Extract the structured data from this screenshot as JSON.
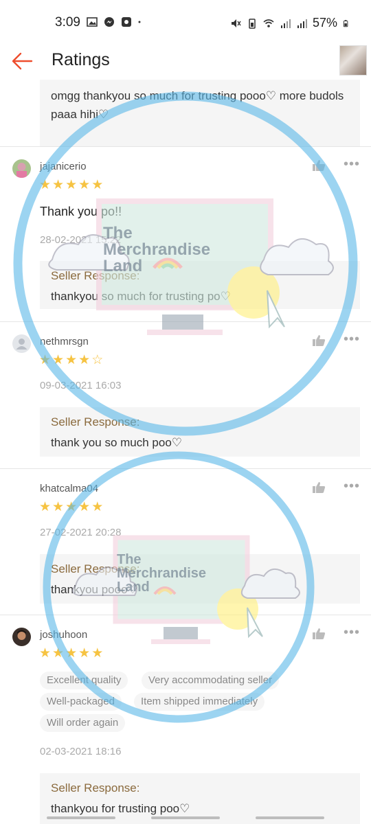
{
  "status_bar": {
    "time": "3:09",
    "battery": "57%"
  },
  "header": {
    "title": "Ratings"
  },
  "top_partial": {
    "response_text": "omgg thankyou so much for trusting pooo♡ more budols paaa hihi♡"
  },
  "reviews": [
    {
      "username": "jajanicerio",
      "stars": 5,
      "comment": "Thank you po!!",
      "date": "28-02-2021 15:22",
      "response_label": "Seller Response:",
      "response_text": "thankyou so much for trusting po♡"
    },
    {
      "username": "nethmrsgn",
      "stars": 4,
      "comment": "",
      "date": "09-03-2021 16:03",
      "response_label": "Seller Response:",
      "response_text": "thank you so much poo♡"
    },
    {
      "username": "khatcalma04",
      "stars": 5,
      "comment": "",
      "date": "27-02-2021 20:28",
      "response_label": "Seller Response:",
      "response_text": "thankyou pooo♡"
    },
    {
      "username": "joshuhoon",
      "stars": 5,
      "tags": [
        "Excellent quality",
        "Very accommodating seller",
        "Well-packaged",
        "Item shipped immediately",
        "Will order again"
      ],
      "date": "02-03-2021 18:16",
      "response_label": "Seller Response:",
      "response_text": "thankyou for trusting poo♡"
    }
  ],
  "watermark": {
    "line1": "The",
    "line2": "Merchrandise",
    "line3": "Land"
  },
  "colors": {
    "accent": "#ee4d2d",
    "star": "#f6c342",
    "response_label": "#8a6a3d",
    "watermark_ring": "#5bb8e8"
  }
}
